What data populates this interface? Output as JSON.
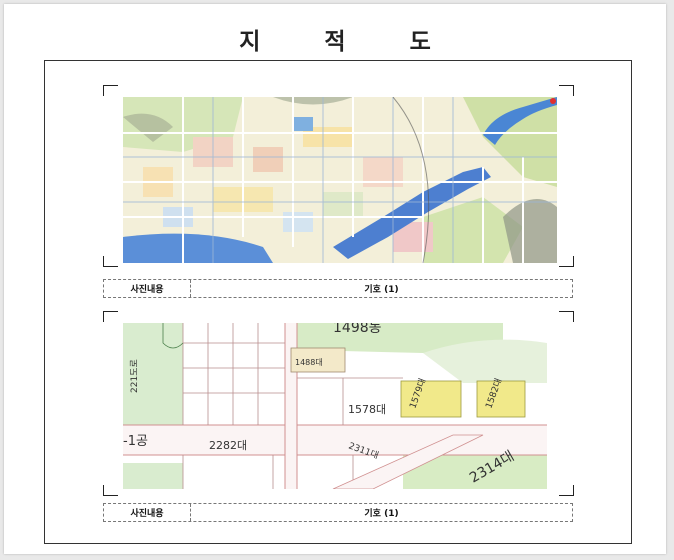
{
  "document": {
    "title": "지 적 도"
  },
  "sections": [
    {
      "caption_label": "사진내용",
      "caption_value": "기호 (1)"
    },
    {
      "caption_label": "사진내용",
      "caption_value": "기호 (1)",
      "map_labels": [
        "1498동",
        "1488대",
        "221도로",
        "1578대",
        "1579대",
        "1582대",
        "2282대",
        "2311대",
        "2314대",
        "-1공"
      ]
    }
  ]
}
